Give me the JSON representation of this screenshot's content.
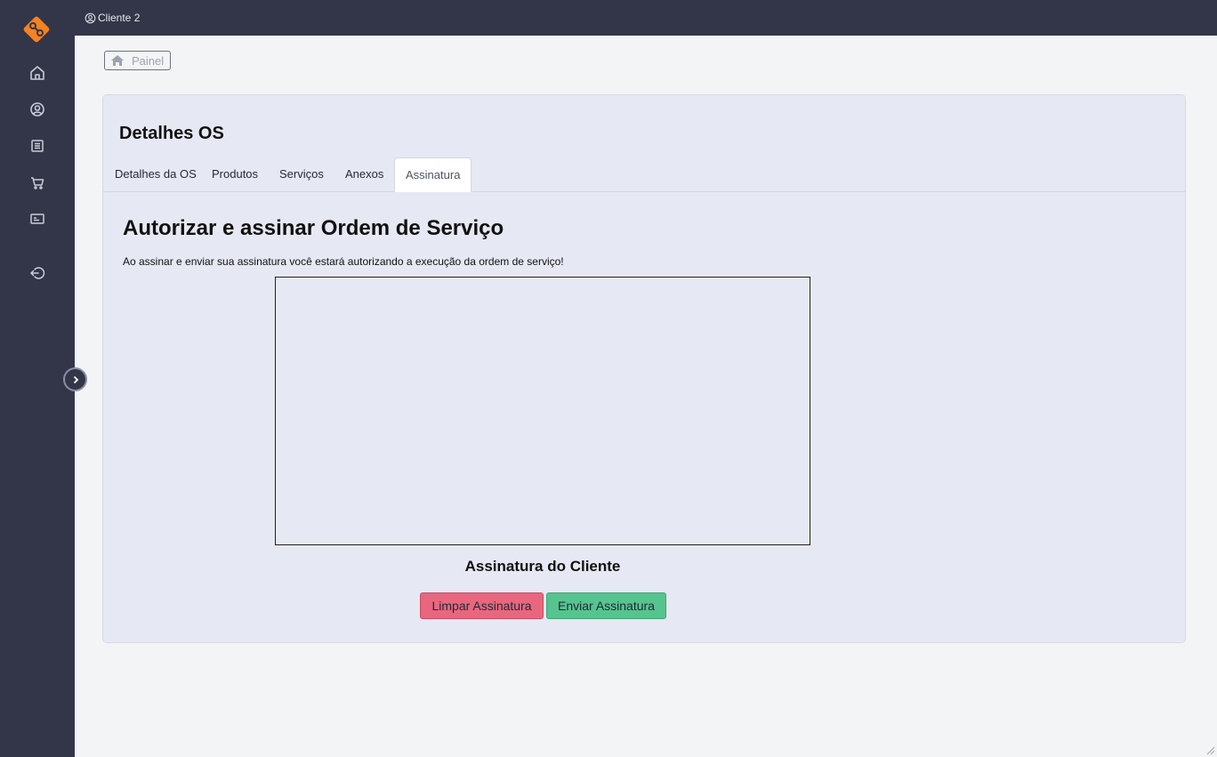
{
  "topbar": {
    "user_label": "Cliente 2"
  },
  "breadcrumb": {
    "label": "Painel"
  },
  "card": {
    "title": "Detalhes OS",
    "tabs": [
      {
        "label": "Detalhes da OS",
        "active": false
      },
      {
        "label": "Produtos",
        "active": false
      },
      {
        "label": "Serviços",
        "active": false
      },
      {
        "label": "Anexos",
        "active": false
      },
      {
        "label": "Assinatura",
        "active": true
      }
    ]
  },
  "signature": {
    "heading": "Autorizar e assinar Ordem de Serviço",
    "description": "Ao assinar e enviar sua assinatura você estará autorizando a execução da ordem de serviço!",
    "pad_label": "Assinatura do Cliente",
    "clear_label": "Limpar Assinatura",
    "send_label": "Enviar Assinatura"
  },
  "icons": {
    "sidebar": [
      "home-icon",
      "user-circle-icon",
      "list-icon",
      "cart-icon",
      "id-card-icon",
      "logout-icon"
    ],
    "toggle": "chevron-right-icon"
  },
  "colors": {
    "sidebar": "#333649",
    "brand": "#f58220",
    "card": "#e6e8f3",
    "clear_button": "#e8677f",
    "send_button": "#56c48e"
  }
}
